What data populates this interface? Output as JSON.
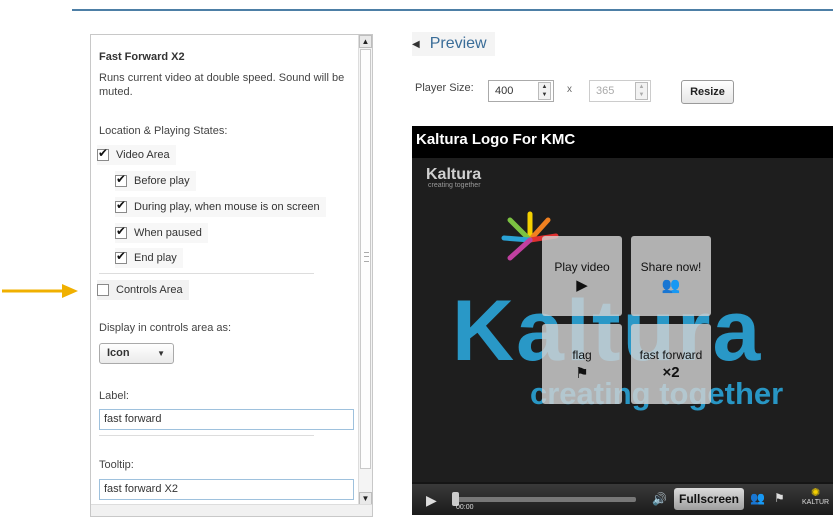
{
  "panel": {
    "title": "Fast Forward X2",
    "description": "Runs current video at double speed. Sound will be muted.",
    "location_label": "Location & Playing States:",
    "checkboxes": [
      {
        "label": "Video Area",
        "checked": true
      },
      {
        "label": "Before play",
        "checked": true
      },
      {
        "label": "During play, when mouse is on screen",
        "checked": true
      },
      {
        "label": "When paused",
        "checked": true
      },
      {
        "label": "End play",
        "checked": true
      },
      {
        "label": "Controls Area",
        "checked": false
      }
    ],
    "display_label": "Display in controls area as:",
    "display_value": "Icon",
    "label_caption": "Label:",
    "label_value": "fast forward",
    "tooltip_caption": "Tooltip:",
    "tooltip_value": "fast forward X2"
  },
  "preview": {
    "heading": "Preview",
    "player_size_label": "Player Size:",
    "width": "400",
    "x_sep": "x",
    "height": "365",
    "resize_label": "Resize"
  },
  "player": {
    "title": "Kaltura Logo For KMC",
    "logo_text": "Kaltura",
    "logo_sub": "creating together",
    "big_text": "Kaltura",
    "big_sub": "creating together",
    "tiles": {
      "play": "Play video",
      "share": "Share now!",
      "flag": "flag",
      "ff": "fast forward",
      "ff_sub": "×2"
    },
    "time": "00:00",
    "fullscreen": "Fullscreen",
    "brand": "KALTUR"
  },
  "colors": {
    "accent": "#3a6d98",
    "arrow": "#f0b000",
    "kaltura_blue": "#2aa3d6"
  }
}
